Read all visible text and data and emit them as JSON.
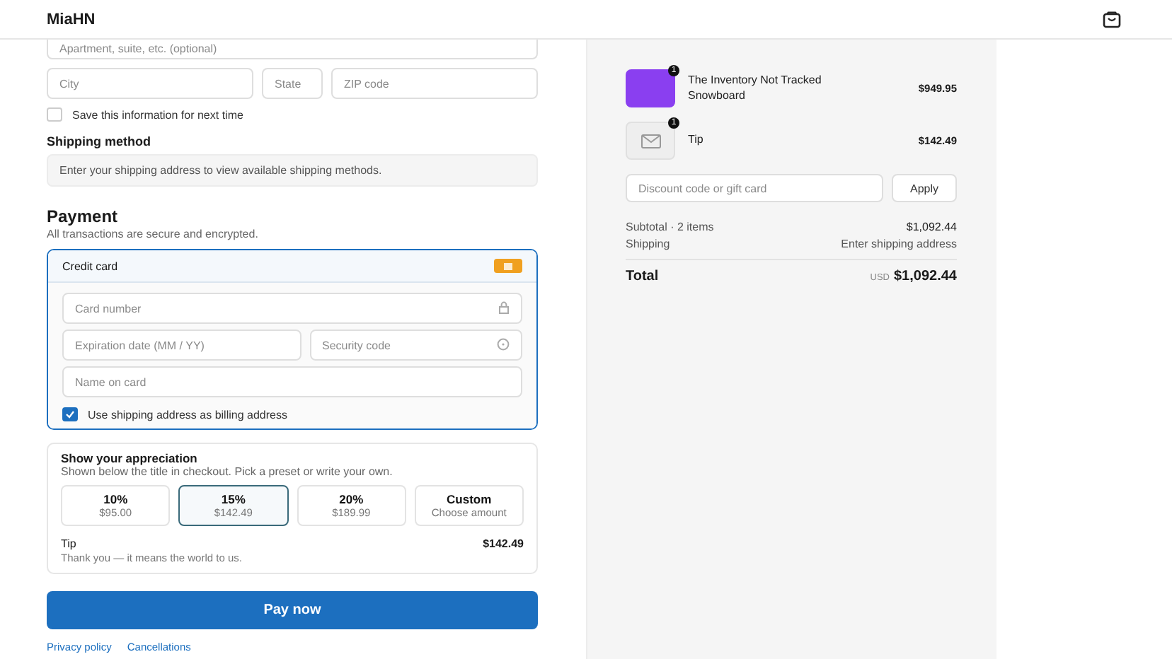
{
  "header": {
    "logo": "MiaHN"
  },
  "address": {
    "apartment_placeholder": "Apartment, suite, etc. (optional)",
    "city_placeholder": "City",
    "state_placeholder": "State",
    "zip_placeholder": "ZIP code"
  },
  "save_info": {
    "label": "Save this information for next time",
    "checked": false
  },
  "shipping_method": {
    "title": "Shipping method",
    "message": "Enter your shipping address to view available shipping methods."
  },
  "payment": {
    "title": "Payment",
    "subtitle": "All transactions are secure and encrypted.",
    "method": "Credit card",
    "card_number_placeholder": "Card number",
    "expiry_placeholder": "Expiration date (MM / YY)",
    "security_placeholder": "Security code",
    "name_placeholder": "Name on card",
    "billing_label": "Use shipping address as billing address",
    "billing_checked": true
  },
  "tip": {
    "title": "Show your appreciation",
    "subtitle": "Shown below the title in checkout. Pick a preset or write your own.",
    "options": [
      {
        "label": "10%",
        "amount": "$95.00",
        "selected": false
      },
      {
        "label": "15%",
        "amount": "$142.49",
        "selected": true
      },
      {
        "label": "20%",
        "amount": "$189.99",
        "selected": false
      },
      {
        "label": "Custom",
        "amount": "Choose amount",
        "selected": false
      }
    ],
    "label": "Tip",
    "note": "Thank you — it means the world to us.",
    "value": "$142.49"
  },
  "pay_button": "Pay now",
  "footer_links": [
    "Privacy policy",
    "Cancellations"
  ],
  "summary": {
    "items": [
      {
        "kind": "product",
        "name": "The Inventory Not Tracked Snowboard",
        "quantity": "1",
        "price": "$949.95"
      },
      {
        "kind": "tip",
        "name": "Tip",
        "quantity": "1",
        "price": "$142.49"
      }
    ],
    "discount_placeholder": "Discount code or gift card",
    "apply": "Apply",
    "subtotal_label": "Subtotal · 2 items",
    "subtotal": "$1,092.44",
    "shipping_label": "Shipping",
    "shipping": "Enter shipping address",
    "total_label": "Total",
    "currency": "USD",
    "total": "$1,092.44"
  }
}
